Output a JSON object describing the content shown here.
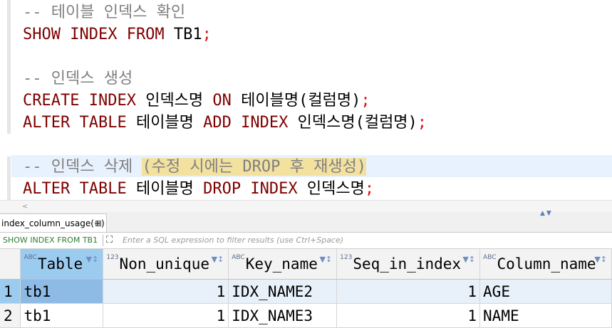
{
  "editor": {
    "line1": "-- 테이블 인덱스 확인",
    "line2_kw": "SHOW INDEX FROM",
    "line2_id": " TB1",
    "line4": "-- 인덱스 생성",
    "line5_kw1": "CREATE INDEX",
    "line5_id1": " 인덱스명 ",
    "line5_kw2": "ON",
    "line5_id2": " 테이블명(컬럼명)",
    "line6_kw1": "ALTER TABLE",
    "line6_id1": " 테이블명 ",
    "line6_kw2": "ADD INDEX",
    "line6_id2": " 인덱스명(컬럼명)",
    "line8_a": "-- 인덱스 삭제 ",
    "line8_b": "(수정 시에는 DROP 후 재생성)",
    "line9_kw1": "ALTER TABLE",
    "line9_id1": " 테이블명 ",
    "line9_kw2": "DROP INDEX",
    "line9_id2": " 인덱스명",
    "semicolon": ";"
  },
  "results": {
    "tab_label": "index_column_usage(+)",
    "tab_close": "⊠",
    "query_label": "SHOW INDEX FROM TB1",
    "filter_placeholder": "Enter a SQL expression to filter results (use Ctrl+Space)",
    "type_abc": "ABC",
    "type_123": "123",
    "columns": [
      "Table",
      "Non_unique",
      "Key_name",
      "Seq_in_index",
      "Column_name"
    ],
    "column_types": [
      "abc",
      "123",
      "abc",
      "123",
      "abc"
    ],
    "rows": [
      {
        "n": "1",
        "table": "tb1",
        "non_unique": "1",
        "key_name": "IDX_NAME2",
        "seq": "1",
        "column": "AGE"
      },
      {
        "n": "2",
        "table": "tb1",
        "non_unique": "1",
        "key_name": "IDX_NAME3",
        "seq": "1",
        "column": "NAME"
      }
    ]
  }
}
